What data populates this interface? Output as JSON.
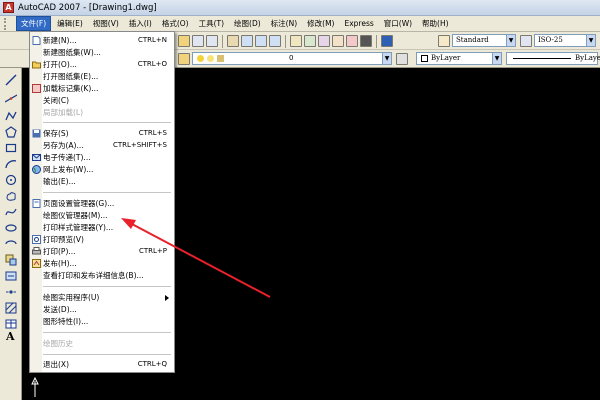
{
  "window": {
    "title": "AutoCAD 2007 - [Drawing1.dwg]",
    "app_icon_letter": "A"
  },
  "menubar": {
    "items": [
      {
        "label": "文件(F)",
        "active": true
      },
      {
        "label": "编辑(E)"
      },
      {
        "label": "视图(V)"
      },
      {
        "label": "插入(I)"
      },
      {
        "label": "格式(O)"
      },
      {
        "label": "工具(T)"
      },
      {
        "label": "绘图(D)"
      },
      {
        "label": "标注(N)"
      },
      {
        "label": "修改(M)"
      },
      {
        "label": "Express"
      },
      {
        "label": "窗口(W)"
      },
      {
        "label": "帮助(H)"
      }
    ]
  },
  "styles_toolbar": {
    "text_style": "Standard",
    "dim_style": "ISO-25"
  },
  "layers_toolbar": {
    "current_layer": "0",
    "color": "ByLayer",
    "linetype": "ByLayer"
  },
  "file_menu": {
    "items": [
      {
        "label": "新建(N)...",
        "shortcut": "CTRL+N",
        "icon": "new-file-icon"
      },
      {
        "label": "新建图纸集(W)...",
        "shortcut": ""
      },
      {
        "label": "打开(O)...",
        "shortcut": "CTRL+O",
        "icon": "open-folder-icon"
      },
      {
        "label": "打开图纸集(E)...",
        "shortcut": ""
      },
      {
        "label": "加载标记集(K)...",
        "shortcut": "",
        "icon": "markup-icon"
      },
      {
        "label": "关闭(C)",
        "shortcut": ""
      },
      {
        "label": "局部加载(L)",
        "shortcut": "",
        "disabled": true
      },
      {
        "label": "保存(S)",
        "shortcut": "CTRL+S",
        "icon": "save-disk-icon"
      },
      {
        "label": "另存为(A)...",
        "shortcut": "CTRL+SHIFT+S"
      },
      {
        "label": "电子传递(T)...",
        "shortcut": "",
        "icon": "etransmit-icon"
      },
      {
        "label": "网上发布(W)...",
        "shortcut": "",
        "icon": "publish-web-icon"
      },
      {
        "label": "输出(E)...",
        "shortcut": ""
      },
      {
        "label": "页面设置管理器(G)...",
        "shortcut": "",
        "icon": "page-setup-icon"
      },
      {
        "label": "绘图仪管理器(M)...",
        "shortcut": ""
      },
      {
        "label": "打印样式管理器(Y)...",
        "shortcut": ""
      },
      {
        "label": "打印预览(V)",
        "shortcut": "",
        "icon": "print-preview-icon"
      },
      {
        "label": "打印(P)...",
        "shortcut": "CTRL+P",
        "icon": "print-icon"
      },
      {
        "label": "发布(H)...",
        "shortcut": "",
        "icon": "publish-icon"
      },
      {
        "label": "查看打印和发布详细信息(B)...",
        "shortcut": ""
      },
      {
        "label": "绘图实用程序(U)",
        "shortcut": "",
        "submenu": true
      },
      {
        "label": "发送(D)...",
        "shortcut": ""
      },
      {
        "label": "图形特性(I)...",
        "shortcut": ""
      },
      {
        "label": "绘图历史",
        "shortcut": "",
        "disabled": true
      },
      {
        "label": "退出(X)",
        "shortcut": "CTRL+Q"
      }
    ]
  },
  "colors": {
    "arrow": "#e8212a",
    "menu_highlight": "#316ac5",
    "canvas": "#000000"
  }
}
